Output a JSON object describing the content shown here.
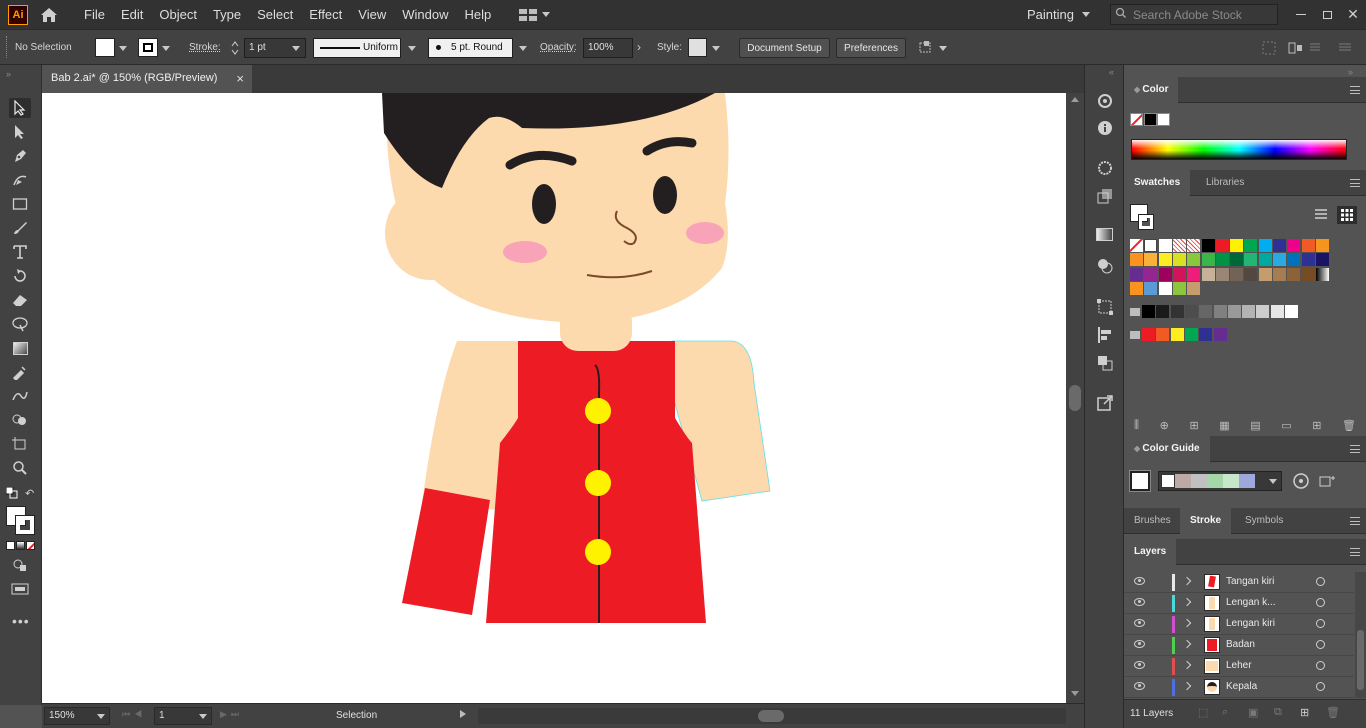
{
  "app": {
    "logo": "Ai"
  },
  "menubar": {
    "items": [
      "File",
      "Edit",
      "Object",
      "Type",
      "Select",
      "Effect",
      "View",
      "Window",
      "Help"
    ],
    "workspace": "Painting",
    "search_placeholder": "Search Adobe Stock"
  },
  "controlbar": {
    "selection_label": "No Selection",
    "stroke_label": "Stroke:",
    "stroke_weight": "1 pt",
    "profile": "Uniform",
    "brush": "5 pt. Round",
    "opacity_label": "Opacity:",
    "opacity": "100%",
    "style_label": "Style:",
    "document_setup": "Document Setup",
    "preferences": "Preferences"
  },
  "document": {
    "tab_title": "Bab 2.ai* @ 150% (RGB/Preview)",
    "close": "×"
  },
  "status": {
    "zoom": "150%",
    "page": "1",
    "tool": "Selection"
  },
  "panels": {
    "color": {
      "title": "Color"
    },
    "swatches": {
      "tabs": [
        "Swatches",
        "Libraries"
      ]
    },
    "color_guide": {
      "title": "Color Guide"
    },
    "stroke_group": {
      "tabs": [
        "Brushes",
        "Stroke",
        "Symbols"
      ]
    },
    "layers": {
      "title": "Layers",
      "count": "11 Layers",
      "rows": [
        {
          "name": "Tangan kiri",
          "color": "#e8e8e8"
        },
        {
          "name": "Lengan k...",
          "color": "#4fd6d6"
        },
        {
          "name": "Lengan kiri",
          "color": "#d04fd0"
        },
        {
          "name": "Badan",
          "color": "#4fd04f"
        },
        {
          "name": "Leher",
          "color": "#e04f4f"
        },
        {
          "name": "Kepala",
          "color": "#4f6fe0"
        }
      ]
    }
  },
  "tools": [
    "selection-icon",
    "direct-selection-icon",
    "pen-icon",
    "curvature-icon",
    "rectangle-icon",
    "paintbrush-icon",
    "type-icon",
    "rotate-icon",
    "eraser-icon",
    "warp-icon",
    "gradient-icon",
    "eyedropper-icon",
    "blend-icon",
    "shape-builder-icon",
    "artboard-icon",
    "zoom-icon"
  ],
  "colors": {
    "accent_orange": "#ff9a00",
    "shirt_red": "#ed1c24",
    "skin": "#fdd9ae",
    "hair": "#231f20",
    "button_yellow": "#fff200",
    "blush_pink": "#f9a3b8"
  }
}
